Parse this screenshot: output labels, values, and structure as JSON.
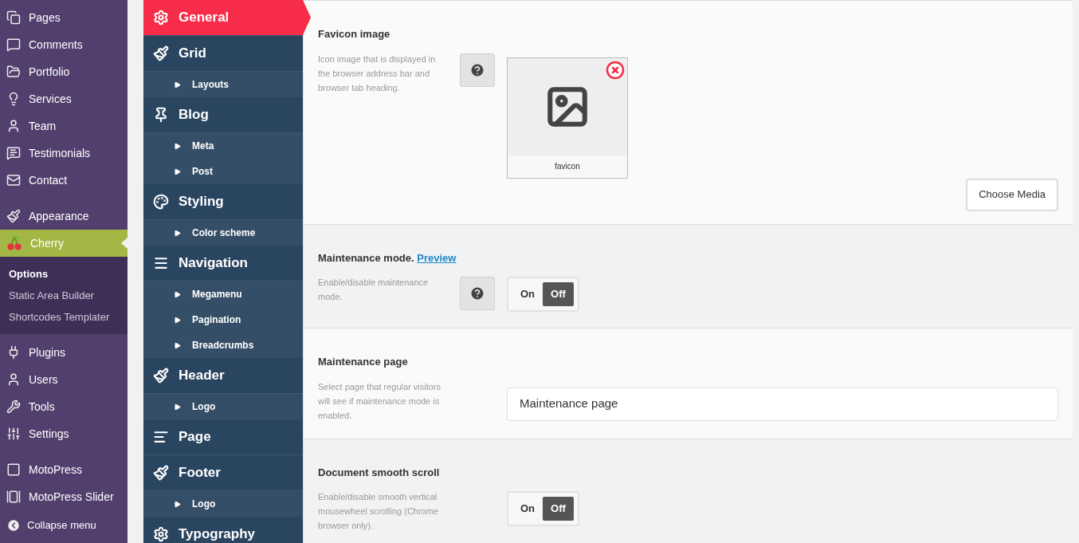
{
  "admin_menu": {
    "groups": [
      [
        {
          "label": "Pages",
          "selected": false
        },
        {
          "label": "Comments",
          "selected": false
        },
        {
          "label": "Portfolio",
          "selected": false
        },
        {
          "label": "Services",
          "selected": false
        },
        {
          "label": "Team",
          "selected": false
        },
        {
          "label": "Testimonials",
          "selected": false
        },
        {
          "label": "Contact",
          "selected": false
        }
      ],
      [
        {
          "label": "Appearance",
          "selected": false
        },
        {
          "label": "Cherry",
          "selected": true,
          "submenu": [
            {
              "label": "Options",
              "selected": true
            },
            {
              "label": "Static Area Builder",
              "selected": false
            },
            {
              "label": "Shortcodes Templater",
              "selected": false
            }
          ]
        },
        {
          "label": "Plugins",
          "selected": false
        },
        {
          "label": "Users",
          "selected": false
        },
        {
          "label": "Tools",
          "selected": false
        },
        {
          "label": "Settings",
          "selected": false
        }
      ],
      [
        {
          "label": "MotoPress",
          "selected": false
        },
        {
          "label": "MotoPress Slider",
          "selected": false
        }
      ]
    ],
    "collapse": "Collapse menu"
  },
  "options_menu": [
    {
      "label": "General",
      "selected": true
    },
    {
      "label": "Grid",
      "selected": false,
      "children": [
        "Layouts"
      ]
    },
    {
      "label": "Blog",
      "selected": false,
      "children": [
        "Meta",
        "Post"
      ]
    },
    {
      "label": "Styling",
      "selected": false,
      "children": [
        "Color scheme"
      ]
    },
    {
      "label": "Navigation",
      "selected": false,
      "children": [
        "Megamenu",
        "Pagination",
        "Breadcrumbs"
      ]
    },
    {
      "label": "Header",
      "selected": false,
      "children": [
        "Logo"
      ]
    },
    {
      "label": "Page",
      "selected": false
    },
    {
      "label": "Footer",
      "selected": false,
      "children": [
        "Logo"
      ]
    },
    {
      "label": "Typography",
      "selected": false
    }
  ],
  "settings": [
    {
      "kind": "media",
      "title": "Favicon image",
      "description": "Icon image that is displayed in the browser address bar and browser tab heading.",
      "help": true,
      "file_name": "favicon",
      "button": "Choose Media"
    },
    {
      "kind": "toggle",
      "title": "Maintenance mode.",
      "link": "Preview",
      "description": "Enable/disable maintenance mode.",
      "help": true,
      "options": [
        {
          "label": "On",
          "selected": false
        },
        {
          "label": "Off",
          "selected": true
        }
      ]
    },
    {
      "kind": "select",
      "title": "Maintenance page",
      "description": "Select page that regular visitors will see if maintenance mode is enabled.",
      "help": false,
      "value": "Maintenance page"
    },
    {
      "kind": "toggle",
      "title": "Document smooth scroll",
      "description": "Enable/disable smooth vertical mousewheel scrolling (Chrome browser only).",
      "help": false,
      "options": [
        {
          "label": "On",
          "selected": false
        },
        {
          "label": "Off",
          "selected": true
        }
      ]
    }
  ]
}
